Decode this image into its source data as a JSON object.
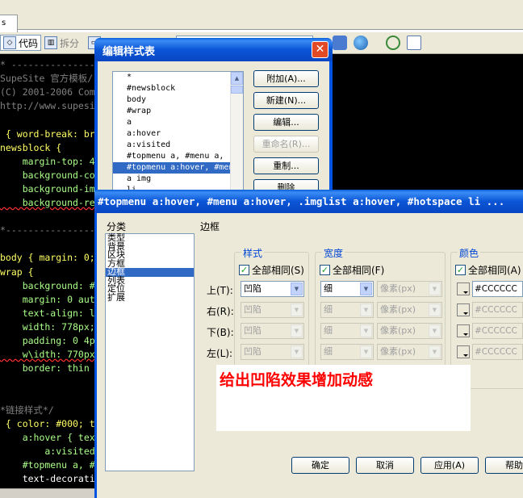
{
  "background_editor": {
    "tab_label": "s",
    "toolbar": {
      "code_label": "代码",
      "split_label": "拆分"
    },
    "code_lines": [
      {
        "text": "* ---------------------------",
        "cls": "c-gray"
      },
      {
        "text": "SupeSite 官方模板/",
        "cls": "c-gray"
      },
      {
        "text": "(C) 2001-2006 Com",
        "cls": "c-gray"
      },
      {
        "text": "http://www.supesi",
        "cls": "c-gray"
      },
      {
        "text": "",
        "cls": ""
      },
      {
        "text": " { word-break: bre",
        "cls": "c-yellow"
      },
      {
        "text": "newsblock {",
        "cls": "c-yellow"
      },
      {
        "text": "    margin-top: 4px",
        "cls": "c-green"
      },
      {
        "text": "    background-colo",
        "cls": "c-green"
      },
      {
        "text": "    background-ima",
        "cls": "c-green"
      },
      {
        "text": "    background-rep",
        "cls": "c-green c-squig"
      },
      {
        "text": "",
        "cls": ""
      },
      {
        "text": "*--------------------------------",
        "cls": "c-gray"
      },
      {
        "text": "",
        "cls": ""
      },
      {
        "text": "body { margin: 0;",
        "cls": "c-yellow"
      },
      {
        "text": "wrap {",
        "cls": "c-yellow"
      },
      {
        "text": "    background: #F",
        "cls": "c-green"
      },
      {
        "text": "    margin: 0 auto",
        "cls": "c-green"
      },
      {
        "text": "    text-align: le",
        "cls": "c-green"
      },
      {
        "text": "    width: 778px;",
        "cls": "c-green"
      },
      {
        "text": "    padding: 0 4px",
        "cls": "c-green"
      },
      {
        "text": "    w\\idth: 770px;",
        "cls": "c-green c-squig"
      },
      {
        "text": "    border: thin d",
        "cls": "c-green"
      },
      {
        "text": "",
        "cls": ""
      },
      {
        "text": "",
        "cls": ""
      },
      {
        "text": "*链接样式*/",
        "cls": "c-gray"
      },
      {
        "text": " { color: #000; t",
        "cls": "c-yellow"
      },
      {
        "text": "    a:hover { text",
        "cls": "c-green"
      },
      {
        "text": "        a:visited",
        "cls": "c-green"
      },
      {
        "text": "    #topmenu a, #m",
        "cls": "c-green"
      },
      {
        "text": "    text-decoration: none",
        "cls": "c-sel"
      }
    ]
  },
  "style_sheet_dialog": {
    "title": "编辑样式表",
    "close_glyph": "✕",
    "selectors": [
      "*",
      "#newsblock",
      "body",
      "#wrap",
      "a",
      "a:hover",
      "a:visited",
      "#topmenu a, #menu a, .",
      "#topmenu a:hover, #men",
      "a img",
      "li"
    ],
    "selected_index": 8,
    "buttons": {
      "attach": "附加(A)...",
      "new": "新建(N)...",
      "edit": "编辑...",
      "rename": "重命名(R)...",
      "duplicate": "重制...",
      "delete": "删除"
    }
  },
  "rule_dialog": {
    "title": "#topmenu a:hover, #menu a:hover, .imglist a:hover, #hotspace li ...",
    "category_label": "分类",
    "categories": [
      "类型",
      "背景",
      "区块",
      "方框",
      "边框",
      "列表",
      "定位",
      "扩展"
    ],
    "selected_category": 4,
    "panel_title": "边框",
    "style_group": {
      "legend": "样式",
      "same_for_all": "全部相同(S)",
      "values": [
        "凹陷",
        "凹陷",
        "凹陷",
        "凹陷"
      ]
    },
    "width_group": {
      "legend": "宽度",
      "same_for_all": "全部相同(F)",
      "values": [
        "细",
        "细",
        "细",
        "细"
      ],
      "units": [
        "像素(px)",
        "像素(px)",
        "像素(px)",
        "像素(px)"
      ]
    },
    "color_group": {
      "legend": "颜色",
      "same_for_all": "全部相同(A)",
      "values": [
        "#CCCCCC",
        "#CCCCCC",
        "#CCCCCC",
        "#CCCCCC"
      ]
    },
    "side_labels": [
      "上(T):",
      "右(R):",
      "下(B):",
      "左(L):"
    ],
    "check_glyph": "✓",
    "annotation": "给出凹陷效果增加动感",
    "buttons": {
      "ok": "确定",
      "cancel": "取消",
      "apply": "应用(A)",
      "help": "帮助"
    }
  }
}
